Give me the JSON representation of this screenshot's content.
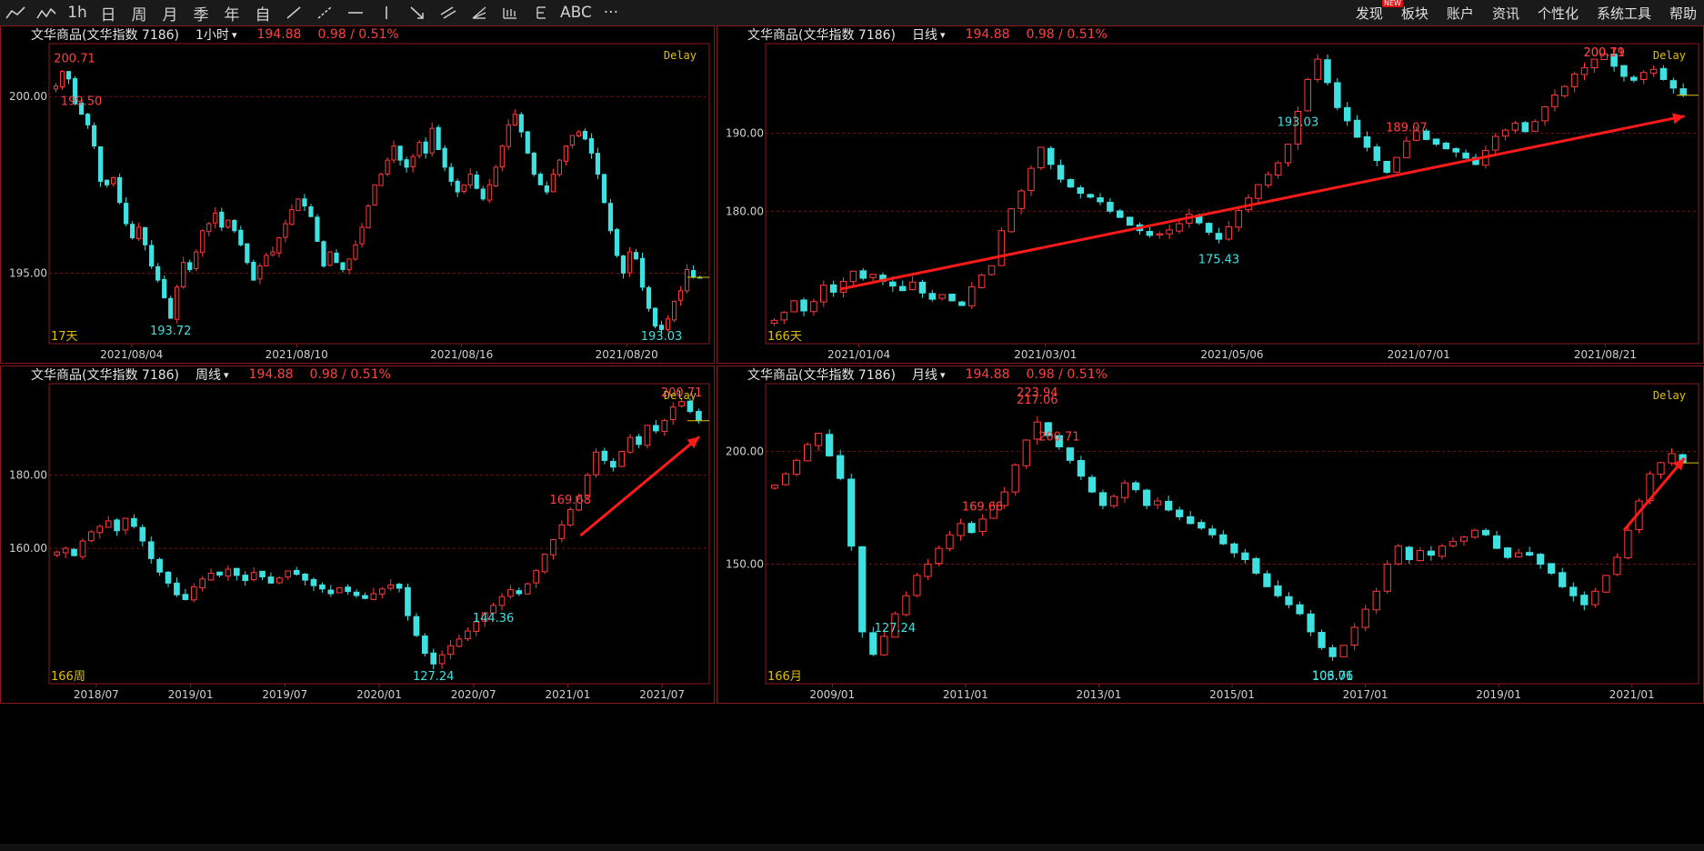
{
  "toolbar": {
    "left_items": [
      {
        "icon": "line-tool-icon",
        "label": ""
      },
      {
        "icon": "multi-line-tool-icon",
        "label": ""
      },
      {
        "icon": "",
        "label": "1h"
      },
      {
        "icon": "",
        "label": "日"
      },
      {
        "icon": "",
        "label": "周"
      },
      {
        "icon": "",
        "label": "月"
      },
      {
        "icon": "",
        "label": "季"
      },
      {
        "icon": "",
        "label": "年"
      },
      {
        "icon": "",
        "label": "自"
      },
      {
        "icon": "diagonal-line-icon",
        "label": ""
      },
      {
        "icon": "ray-line-icon",
        "label": ""
      },
      {
        "icon": "horizontal-line-icon",
        "label": ""
      },
      {
        "icon": "vertical-line-icon",
        "label": ""
      },
      {
        "icon": "arrow-tool-icon",
        "label": ""
      },
      {
        "icon": "parallel-channel-icon",
        "label": ""
      },
      {
        "icon": "fibonacci-fan-icon",
        "label": ""
      },
      {
        "icon": "bar-pattern-icon",
        "label": ""
      },
      {
        "icon": "fibonacci-retracement-icon",
        "label": ""
      },
      {
        "icon": "",
        "label": "ABC"
      },
      {
        "icon": "more-icon",
        "label": "···"
      }
    ],
    "right_menu": [
      "发现",
      "板块",
      "账户",
      "资讯",
      "个性化",
      "系统工具",
      "帮助"
    ],
    "new_badge": "NEW",
    "colors": {
      "text": "#d0d0d0",
      "badge": "#e01010"
    }
  },
  "panels": [
    {
      "id": "p1",
      "name": "文华商品(文华指数 7186)",
      "period": "1小时",
      "price": "194.88",
      "change": "0.98 / 0.51%",
      "delay": "Delay",
      "count_label": "17天",
      "chart_data": {
        "type": "candlestick",
        "x_ticks": [
          "2021/08/04",
          "2021/08/10",
          "2021/08/16",
          "2021/08/20"
        ],
        "y_ticks": [
          "200.00",
          "195.00"
        ],
        "ylim": [
          193.0,
          201.5
        ],
        "annotations": [
          {
            "label": "200.71",
            "value": 200.71,
            "kind": "high"
          },
          {
            "label": "199.50",
            "value": 199.5,
            "kind": "high"
          },
          {
            "label": "193.72",
            "value": 193.72,
            "kind": "low"
          },
          {
            "label": "193.03",
            "value": 193.03,
            "kind": "low"
          }
        ],
        "closes": [
          200.3,
          200.71,
          200.5,
          199.8,
          199.5,
          199.2,
          198.6,
          197.6,
          197.5,
          197.7,
          197.0,
          196.4,
          196.0,
          196.3,
          195.8,
          195.2,
          194.8,
          194.3,
          193.72,
          194.6,
          195.3,
          195.1,
          195.6,
          196.2,
          196.4,
          196.7,
          196.3,
          196.5,
          196.2,
          195.8,
          195.3,
          194.8,
          195.2,
          195.5,
          195.6,
          196.0,
          196.4,
          196.8,
          197.1,
          196.9,
          196.6,
          195.9,
          195.2,
          195.6,
          195.3,
          195.1,
          195.4,
          195.8,
          196.3,
          196.9,
          197.5,
          197.8,
          198.2,
          198.6,
          198.2,
          198.0,
          198.3,
          198.7,
          198.4,
          199.1,
          198.5,
          198.0,
          197.6,
          197.3,
          197.5,
          197.8,
          197.4,
          197.1,
          197.5,
          198.0,
          198.6,
          199.2,
          199.5,
          199.0,
          198.4,
          197.8,
          197.5,
          197.3,
          197.8,
          198.2,
          198.6,
          198.9,
          199.0,
          198.8,
          198.4,
          197.8,
          197.0,
          196.2,
          195.5,
          195.0,
          195.6,
          195.4,
          194.6,
          194.0,
          193.5,
          193.4,
          193.7,
          194.2,
          194.5,
          195.1,
          194.9,
          194.88
        ],
        "arrow": null
      }
    },
    {
      "id": "p2",
      "name": "文华商品(文华指数 7186)",
      "period": "日线",
      "price": "194.88",
      "change": "0.98 / 0.51%",
      "delay": "Delay",
      "count_label": "166天",
      "chart_data": {
        "type": "candlestick",
        "x_ticks": [
          "2021/01/04",
          "2021/03/01",
          "2021/05/06",
          "2021/07/01",
          "2021/08/21"
        ],
        "y_ticks": [
          "190.00",
          "180.00"
        ],
        "ylim": [
          163.0,
          201.5
        ],
        "annotations": [
          {
            "label": "189.07",
            "value": 189.07,
            "kind": "high"
          },
          {
            "label": "200.19",
            "value": 200.19,
            "kind": "high"
          },
          {
            "label": "200.71",
            "value": 200.71,
            "kind": "high"
          },
          {
            "label": "175.43",
            "value": 175.43,
            "kind": "low"
          },
          {
            "label": "193.03",
            "value": 193.03,
            "kind": "low"
          }
        ],
        "closes": [
          166.0,
          167.0,
          168.5,
          167.2,
          168.4,
          170.5,
          169.6,
          171.0,
          172.3,
          171.4,
          171.9,
          171.0,
          170.4,
          169.8,
          170.9,
          169.5,
          168.7,
          169.3,
          168.5,
          167.9,
          170.3,
          171.8,
          173.0,
          177.5,
          180.3,
          182.6,
          185.5,
          188.2,
          186.0,
          184.1,
          183.1,
          182.3,
          181.8,
          181.2,
          180.0,
          179.2,
          178.2,
          177.5,
          176.9,
          177.1,
          177.6,
          178.4,
          179.6,
          178.5,
          177.3,
          176.4,
          178.0,
          180.1,
          181.7,
          183.4,
          184.7,
          186.2,
          188.6,
          192.8,
          196.9,
          199.5,
          196.5,
          193.3,
          191.6,
          189.5,
          188.2,
          186.5,
          185.0,
          186.9,
          189.0,
          190.3,
          189.2,
          188.6,
          188.0,
          187.6,
          186.8,
          186.0,
          187.8,
          189.6,
          190.4,
          191.3,
          190.2,
          191.5,
          193.4,
          194.9,
          196.0,
          197.6,
          198.4,
          199.5,
          200.2,
          198.6,
          197.3,
          196.8,
          197.8,
          198.2,
          196.9,
          195.8,
          194.88
        ],
        "arrow": {
          "from": [
            0.08,
            170.0
          ],
          "to": [
            0.985,
            192.2
          ]
        }
      }
    },
    {
      "id": "p3",
      "name": "文华商品(文华指数 7186)",
      "period": "周线",
      "price": "194.88",
      "change": "0.98 / 0.51%",
      "delay": "Delay",
      "count_label": "166周",
      "chart_data": {
        "type": "candlestick",
        "x_ticks": [
          "2018/07",
          "2019/01",
          "2019/07",
          "2020/01",
          "2020/07",
          "2021/01",
          "2021/07"
        ],
        "y_ticks": [
          "180.00",
          "160.00"
        ],
        "ylim": [
          123.0,
          205.0
        ],
        "annotations": [
          {
            "label": "169.68",
            "value": 169.68,
            "kind": "high"
          },
          {
            "label": "200.71",
            "value": 200.71,
            "kind": "high"
          },
          {
            "label": "144.36",
            "value": 144.36,
            "kind": "low"
          },
          {
            "label": "127.24",
            "value": 127.24,
            "kind": "low"
          }
        ],
        "closes": [
          159.0,
          160.0,
          158.0,
          162.0,
          164.5,
          166.0,
          167.5,
          164.8,
          168.2,
          166.0,
          162.0,
          157.2,
          153.5,
          150.5,
          147.3,
          146.0,
          149.5,
          151.6,
          153.2,
          152.7,
          154.3,
          152.6,
          151.2,
          153.4,
          152.2,
          150.5,
          151.9,
          153.8,
          152.9,
          151.3,
          149.8,
          148.9,
          147.6,
          149.2,
          148.2,
          147.1,
          146.3,
          147.6,
          148.9,
          150.0,
          149.1,
          141.6,
          136.2,
          131.3,
          128.4,
          130.9,
          133.4,
          135.2,
          137.4,
          139.9,
          142.4,
          144.4,
          146.8,
          148.7,
          147.6,
          150.3,
          153.9,
          158.4,
          162.4,
          166.4,
          170.6,
          174.2,
          180.0,
          186.3,
          184.0,
          182.2,
          186.5,
          190.3,
          188.4,
          193.6,
          192.1,
          194.9,
          198.6,
          200.1,
          197.4,
          194.88
        ],
        "arrow": {
          "from": [
            0.805,
            163.5
          ],
          "to": [
            0.985,
            190.5
          ]
        }
      }
    },
    {
      "id": "p4",
      "name": "文华商品(文华指数 7186)",
      "period": "月线",
      "price": "194.88",
      "change": "0.98 / 0.51%",
      "delay": "Delay",
      "count_label": "166月",
      "chart_data": {
        "type": "candlestick",
        "x_ticks": [
          "2009/01",
          "2011/01",
          "2013/01",
          "2015/01",
          "2017/01",
          "2019/01",
          "2021/01"
        ],
        "y_ticks": [
          "200.00",
          "150.00"
        ],
        "ylim": [
          97.0,
          230.0
        ],
        "annotations": [
          {
            "label": "217.06",
            "value": 217.06,
            "kind": "high"
          },
          {
            "label": "223.94",
            "value": 223.94,
            "kind": "high"
          },
          {
            "label": "169.68",
            "value": 169.68,
            "kind": "high"
          },
          {
            "label": "200.71",
            "value": 200.71,
            "kind": "high"
          },
          {
            "label": "103.71",
            "value": 103.71,
            "kind": "low"
          },
          {
            "label": "106.06",
            "value": 106.06,
            "kind": "low"
          },
          {
            "label": "127.24",
            "value": 127.24,
            "kind": "low"
          }
        ],
        "closes": [
          185.0,
          190.0,
          196.0,
          203.0,
          208.0,
          198.0,
          188.0,
          158.0,
          120.0,
          110.0,
          118.0,
          128.0,
          136.0,
          145.0,
          150.0,
          157.0,
          163.0,
          168.0,
          164.0,
          170.0,
          176.0,
          182.0,
          194.0,
          205.0,
          213.0,
          207.0,
          202.0,
          196.0,
          189.0,
          182.0,
          176.0,
          180.0,
          186.0,
          183.0,
          176.0,
          178.0,
          174.0,
          171.0,
          168.0,
          166.0,
          163.0,
          159.0,
          155.0,
          152.0,
          146.0,
          140.0,
          136.0,
          132.0,
          128.0,
          120.0,
          113.0,
          109.0,
          114.0,
          122.0,
          130.0,
          138.0,
          150.0,
          158.0,
          152.0,
          156.0,
          154.0,
          158.0,
          160.0,
          162.0,
          165.0,
          163.0,
          157.0,
          153.0,
          155.0,
          154.0,
          150.0,
          146.0,
          140.0,
          136.0,
          132.0,
          138.0,
          145.0,
          153.0,
          165.0,
          178.0,
          190.0,
          195.0,
          199.0,
          194.88
        ],
        "arrow": {
          "from": [
            0.92,
            165.0
          ],
          "to": [
            0.985,
            197.0
          ]
        }
      }
    }
  ]
}
